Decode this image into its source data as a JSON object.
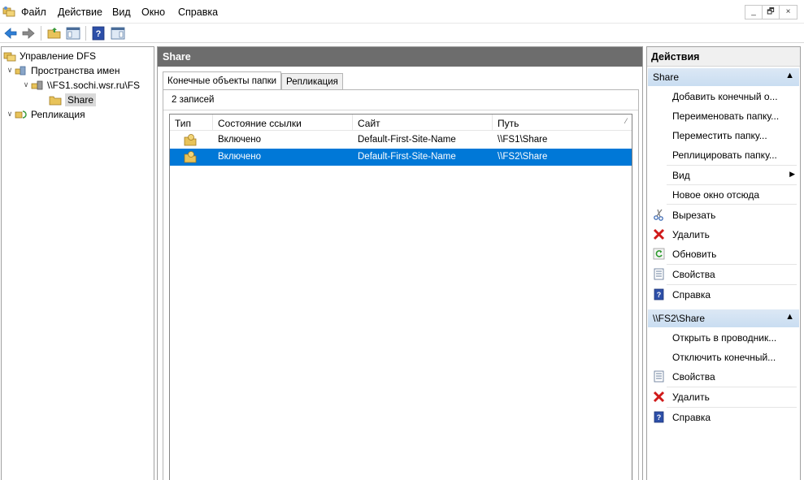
{
  "menu": [
    "Файл",
    "Действие",
    "Вид",
    "Окно",
    "Справка"
  ],
  "window_buttons": [
    "_",
    "🗗",
    "×"
  ],
  "tree": {
    "root": "Управление DFS",
    "namespaces": "Пространства имен",
    "namespace_path": "\\\\FS1.sochi.wsr.ru\\FS",
    "folder": "Share",
    "replication": "Репликация"
  },
  "center": {
    "header": "Share",
    "tabs": [
      "Конечные объекты папки",
      "Репликация"
    ],
    "record_count": "2 записей",
    "columns": [
      "Тип",
      "Состояние ссылки",
      "Сайт",
      "Путь"
    ],
    "rows": [
      {
        "state": "Включено",
        "site": "Default-First-Site-Name",
        "path": "\\\\FS1\\Share"
      },
      {
        "state": "Включено",
        "site": "Default-First-Site-Name",
        "path": "\\\\FS2\\Share"
      }
    ]
  },
  "actions": {
    "title": "Действия",
    "section1": {
      "header": "Share",
      "items": [
        "Добавить конечный о...",
        "Переименовать папку...",
        "Переместить папку...",
        "Реплицировать папку...",
        "Вид",
        "Новое окно отсюда",
        "Вырезать",
        "Удалить",
        "Обновить",
        "Свойства",
        "Справка"
      ]
    },
    "section2": {
      "header": "\\\\FS2\\Share",
      "items": [
        "Открыть в проводник...",
        "Отключить конечный...",
        "Свойства",
        "Удалить",
        "Справка"
      ]
    }
  },
  "colors": {
    "selection": "#0078d7",
    "header_gray": "#6d6d6d",
    "section_blue": "#c9ddf1"
  }
}
